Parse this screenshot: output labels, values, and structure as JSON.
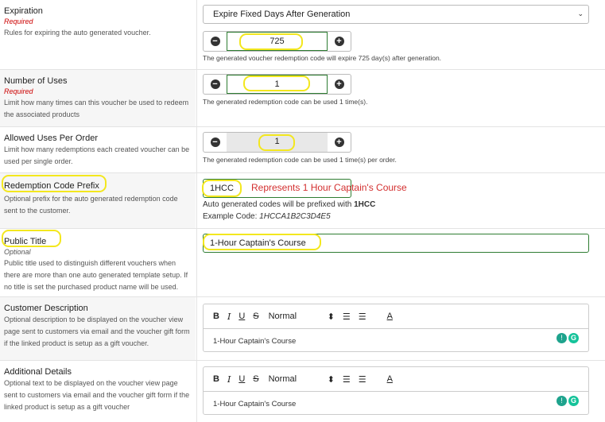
{
  "expiration": {
    "label": "Expiration",
    "required": "Required",
    "description": "Rules for expiring the auto generated voucher.",
    "select_value": "Expire Fixed Days After Generation",
    "days_value": "725",
    "hint": "The generated voucher redemption code will expire 725 day(s) after generation."
  },
  "number_of_uses": {
    "label": "Number of Uses",
    "required": "Required",
    "description": "Limit how many times can this voucher be used to redeem the associated products",
    "value": "1",
    "hint": "The generated redemption code can be used 1 time(s)."
  },
  "allowed_uses": {
    "label": "Allowed Uses Per Order",
    "description": "Limit how many redemptions each created voucher can be used per single order.",
    "value": "1",
    "hint": "The generated redemption code can be used 1 time(s) per order."
  },
  "redemption_prefix": {
    "label": "Redemption Code Prefix",
    "description": "Optional prefix for the auto generated redemption code sent to the customer.",
    "value": "1HCC",
    "annotation": "Represents 1 Hour Captain's Course",
    "prefix_note_text": "Auto generated codes will be prefixed with ",
    "prefix_note_value": "1HCC",
    "example_label": "Example Code: ",
    "example_value": "1HCCA1B2C3D4E5"
  },
  "public_title": {
    "label": "Public Title",
    "optional": "Optional",
    "description": "Public title used to distinguish different vouchers when there are more than one auto generated template setup. If no title is set the purchased product name will be used.",
    "value": "1-Hour Captain's Course"
  },
  "customer_description": {
    "label": "Customer Description",
    "description": "Optional description to be displayed on the voucher view page sent to customers via email and the voucher gift form if the linked product is setup as a gift voucher.",
    "content": "1-Hour Captain's Course"
  },
  "additional_details": {
    "label": "Additional Details",
    "description": "Optional text to be displayed on the voucher view page sent to customers via email and the voucher gift form if the linked product is setup as a gift voucher",
    "content": "1-Hour Captain's Course"
  },
  "toolbar": {
    "bold": "B",
    "italic": "I",
    "underline": "U",
    "strike": "S",
    "format": "Normal",
    "format_arrows": "⬍",
    "ordered_list": "☰",
    "bullet_list": "☰",
    "color": "A"
  },
  "icons": {
    "minus": "−",
    "plus": "+",
    "chevron": "⌄",
    "bulb": "💡",
    "grammarly": "G"
  },
  "highlight_color": "#f3e71e"
}
